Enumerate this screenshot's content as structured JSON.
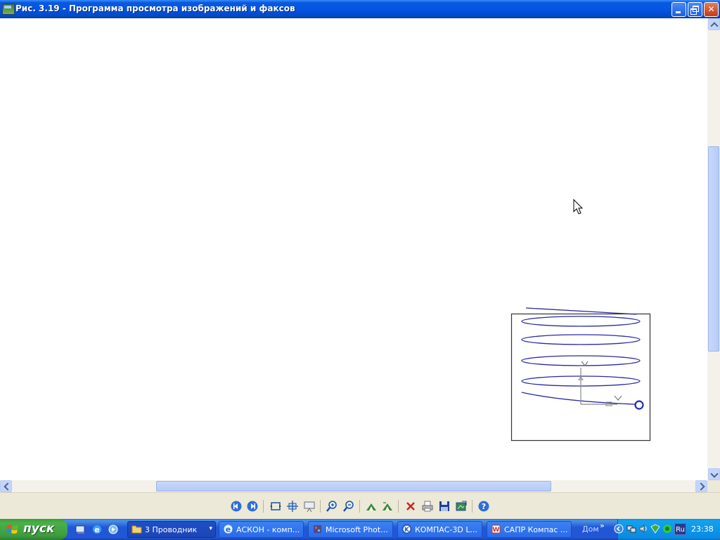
{
  "window": {
    "title": "Рис. 3.19 - Программа просмотра изображений и факсов",
    "buttons": [
      "minimize",
      "maximize",
      "close"
    ]
  },
  "toolbar": {
    "buttons": [
      {
        "name": "previous-image-button",
        "icon": "previous-icon"
      },
      {
        "name": "next-image-button",
        "icon": "next-icon"
      },
      {
        "name": "best-fit-button",
        "icon": "best-fit-icon"
      },
      {
        "name": "actual-size-button",
        "icon": "actual-size-icon"
      },
      {
        "name": "slideshow-button",
        "icon": "slideshow-icon"
      },
      {
        "name": "zoom-in-button",
        "icon": "zoom-in-icon"
      },
      {
        "name": "zoom-out-button",
        "icon": "zoom-out-icon"
      },
      {
        "name": "rotate-clockwise-button",
        "icon": "rotate-cw-icon"
      },
      {
        "name": "rotate-counterclockwise-button",
        "icon": "rotate-ccw-icon"
      },
      {
        "name": "delete-button",
        "icon": "delete-icon"
      },
      {
        "name": "print-button",
        "icon": "print-icon"
      },
      {
        "name": "save-button",
        "icon": "save-icon"
      },
      {
        "name": "edit-button",
        "icon": "edit-icon"
      },
      {
        "name": "help-button",
        "icon": "help-icon"
      }
    ]
  },
  "taskbar": {
    "start_label": "пуск",
    "tasks": [
      {
        "label": "3 Проводник",
        "icon": "folder-icon",
        "active": true
      },
      {
        "label": "АСКОН - комп...",
        "icon": "ie-icon"
      },
      {
        "label": "Microsoft Phot...",
        "icon": "photoshop-icon"
      },
      {
        "label": "КОМПАС-3D L...",
        "icon": "kompas-icon"
      },
      {
        "label": "САПР Компас ...",
        "icon": "word-icon"
      }
    ],
    "toolbar_label": "Дом",
    "chevron": "»",
    "language": "Ru",
    "clock": "23:38"
  },
  "colors": {
    "titlebar": "#0456e2",
    "spring": "#2a2aa0",
    "taskbar": "#2157d7",
    "start": "#3d9c3d"
  }
}
